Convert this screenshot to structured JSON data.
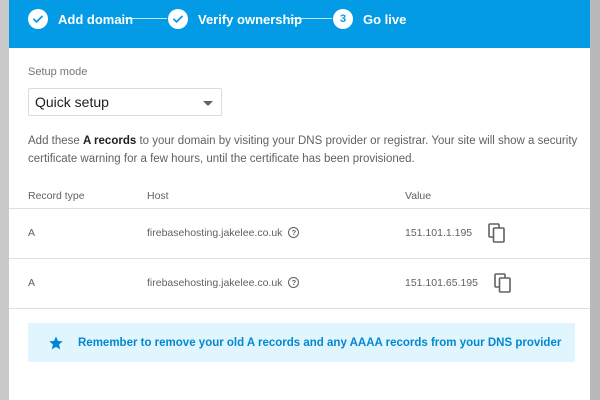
{
  "steps": [
    {
      "label": "Add domain",
      "state": "done"
    },
    {
      "label": "Verify ownership",
      "state": "done"
    },
    {
      "label": "Go live",
      "state": "current",
      "number": "3"
    }
  ],
  "setup": {
    "label": "Setup mode",
    "selected": "Quick setup"
  },
  "description": {
    "before": "Add these ",
    "bold": "A records",
    "after": " to your domain by visiting your DNS provider or registrar. Your site will show a security certificate warning for a few hours, until the certificate has been provisioned."
  },
  "table": {
    "headers": {
      "type": "Record type",
      "host": "Host",
      "value": "Value"
    },
    "rows": [
      {
        "type": "A",
        "host": "firebasehosting.jakelee.co.uk",
        "value": "151.101.1.195"
      },
      {
        "type": "A",
        "host": "firebasehosting.jakelee.co.uk",
        "value": "151.101.65.195"
      }
    ]
  },
  "notice": {
    "text": "Remember to remove your old A records and any AAAA records from your DNS provider"
  },
  "colors": {
    "accent": "#039be5",
    "notice_bg": "#e1f5fe",
    "notice_text": "#0288d1"
  },
  "icons": {
    "done": "check-icon",
    "help": "help-icon",
    "copy": "copy-icon",
    "notice": "star-icon"
  }
}
